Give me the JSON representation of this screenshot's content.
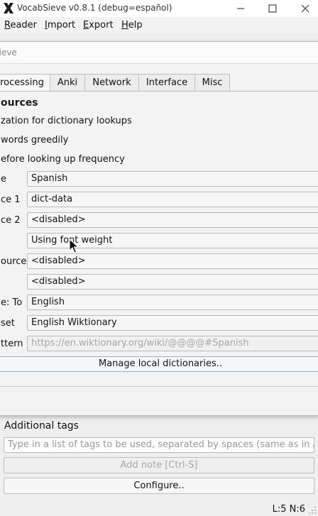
{
  "window": {
    "title": "VocabSieve v0.8.1 (debug=español)"
  },
  "menubar": {
    "items": [
      "Reader",
      "Import",
      "Export",
      "Help"
    ]
  },
  "dialog": {
    "title": "Sieve",
    "tabs": [
      "rocessing",
      "Anki",
      "Network",
      "Interface",
      "Misc"
    ],
    "active_tab": "rocessing",
    "section_heading": "ources",
    "checkbox_texts": [
      "zation for dictionary lookups",
      "words greedily",
      "efore looking up frequency"
    ],
    "rows": [
      {
        "label": "e",
        "value": "Spanish"
      },
      {
        "label": "ce 1",
        "value": "dict-data"
      },
      {
        "label": "ce 2",
        "value": "<disabled>"
      },
      {
        "label": "",
        "value": "Using font weight"
      },
      {
        "label": "ource",
        "value": "<disabled>"
      },
      {
        "label": "",
        "value": "<disabled>"
      },
      {
        "label": "e: To",
        "value": "English"
      },
      {
        "label": "set",
        "value": "English Wiktionary"
      },
      {
        "label": "ttern",
        "value": "https://en.wiktionary.org/wiki/@@@@#Spanish"
      }
    ],
    "manage_button": "Manage local dictionaries.."
  },
  "main": {
    "tags_label": "Additional tags",
    "tags_placeholder": "Type in a list of tags to be used, separated by spaces (same as in Anki).",
    "add_note_button": "Add note [Ctrl-S]",
    "configure_button": "Configure.."
  },
  "status": {
    "text": "L:5 N:6"
  },
  "colors": {
    "accent_border": "#9bb3c8",
    "disabled_text": "#a6a6a6"
  }
}
